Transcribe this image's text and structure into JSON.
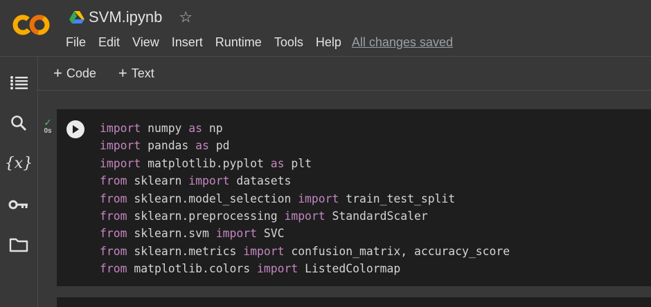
{
  "app": {
    "logo_icon": "colab-logo-icon",
    "drive_icon": "google-drive-icon",
    "doc_title": "SVM.ipynb",
    "star_icon": "star-outline-icon",
    "star_glyph": "☆"
  },
  "menu": {
    "items": [
      "File",
      "Edit",
      "View",
      "Insert",
      "Runtime",
      "Tools",
      "Help"
    ],
    "save_status": "All changes saved"
  },
  "sidebar": {
    "icons": [
      "table-of-contents-icon",
      "search-icon",
      "variables-icon",
      "key-icon",
      "folder-icon"
    ],
    "variables_glyph": "{x}"
  },
  "toolbar": {
    "plus_glyph": "+",
    "add_code": "Code",
    "add_text": "Text"
  },
  "cell": {
    "status_icon": "check-icon",
    "status_glyph": "✓",
    "exec_time": "0s",
    "run_icon": "play-icon",
    "code_lines": [
      [
        {
          "t": "import",
          "kw": true
        },
        {
          "t": " numpy "
        },
        {
          "t": "as",
          "kw": true
        },
        {
          "t": " np"
        }
      ],
      [
        {
          "t": "import",
          "kw": true
        },
        {
          "t": " pandas "
        },
        {
          "t": "as",
          "kw": true
        },
        {
          "t": " pd"
        }
      ],
      [
        {
          "t": "import",
          "kw": true
        },
        {
          "t": " matplotlib.pyplot "
        },
        {
          "t": "as",
          "kw": true
        },
        {
          "t": " plt"
        }
      ],
      [
        {
          "t": "from",
          "kw": true
        },
        {
          "t": " sklearn "
        },
        {
          "t": "import",
          "kw": true
        },
        {
          "t": " datasets"
        }
      ],
      [
        {
          "t": "from",
          "kw": true
        },
        {
          "t": " sklearn.model_selection "
        },
        {
          "t": "import",
          "kw": true
        },
        {
          "t": " train_test_split"
        }
      ],
      [
        {
          "t": "from",
          "kw": true
        },
        {
          "t": " sklearn.preprocessing "
        },
        {
          "t": "import",
          "kw": true
        },
        {
          "t": " StandardScaler"
        }
      ],
      [
        {
          "t": "from",
          "kw": true
        },
        {
          "t": " sklearn.svm "
        },
        {
          "t": "import",
          "kw": true
        },
        {
          "t": " SVC"
        }
      ],
      [
        {
          "t": "from",
          "kw": true
        },
        {
          "t": " sklearn.metrics "
        },
        {
          "t": "import",
          "kw": true
        },
        {
          "t": " confusion_matrix, accuracy_score"
        }
      ],
      [
        {
          "t": "from",
          "kw": true
        },
        {
          "t": " matplotlib.colors "
        },
        {
          "t": "import",
          "kw": true
        },
        {
          "t": " ListedColormap"
        }
      ]
    ]
  },
  "colors": {
    "background": "#383838",
    "cell_background": "#1e1e1e",
    "keyword": "#c586c0",
    "code_text": "#d4d4d4",
    "success": "#56b865",
    "logo_orange": "#f9ab00",
    "logo_dark_orange": "#e8710a"
  }
}
